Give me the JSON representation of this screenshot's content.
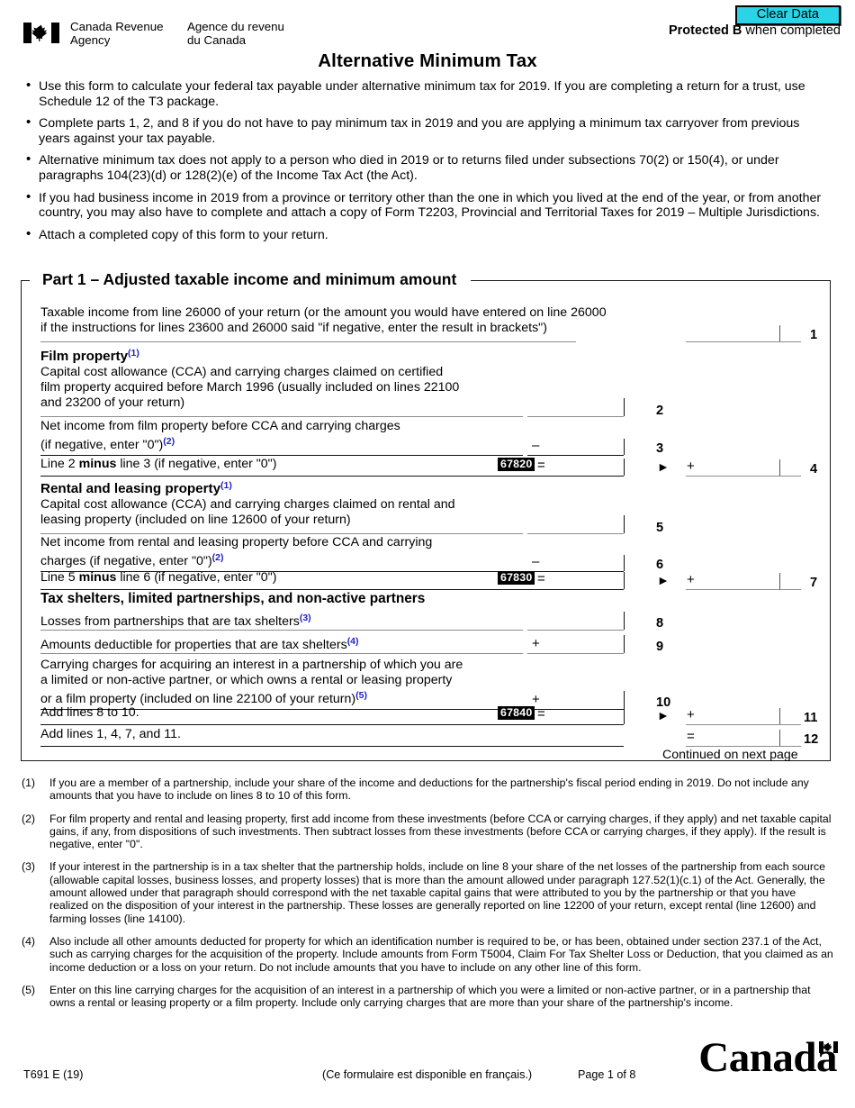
{
  "header": {
    "clear_data_label": "Clear Data",
    "agency_en": "Canada Revenue\nAgency",
    "agency_fr": "Agence du revenu\ndu Canada",
    "protected_strong": "Protected B",
    "protected_rest": " when completed",
    "form_title": "Alternative Minimum Tax"
  },
  "intro_bullets": [
    "Use this form to calculate your federal tax payable under alternative minimum tax for 2019. If you are completing a return for a trust, use Schedule 12 of the T3 package.",
    "Complete parts 1, 2, and 8 if you do not have to pay minimum tax in 2019 and you are applying a minimum tax carryover from previous years against your tax payable.",
    "Alternative minimum tax does not apply to a person who died in 2019 or to returns filed under subsections 70(2) or 150(4), or under paragraphs 104(23)(d) or 128(2)(e) of the Income Tax Act (the Act).",
    "If you had business income in 2019 from a province or territory other than the one in which you lived at the end of the year, or from another country, you may also have to complete and attach a copy of Form T2203, Provincial and Territorial Taxes for 2019 – Multiple Jurisdictions.",
    "Attach a completed copy of this form to your return."
  ],
  "part1": {
    "legend": "Part 1 – Adjusted taxable income and minimum amount",
    "continued": "Continued on next page",
    "line1_label_a": "Taxable income from line 26000 of your return (or the amount you would have entered on line 26000",
    "line1_label_b": "if the instructions for lines 23600 and 26000 said \"if negative, enter the result in brackets\")",
    "line1_num": "1",
    "film_heading": "Film property",
    "film_heading_fn": "(1)",
    "line2_label_a": "Capital cost allowance (CCA) and carrying charges claimed on certified",
    "line2_label_b": "film property acquired before March 1996 (usually included on lines 22100",
    "line2_label_c": "and 23200 of your return)",
    "line2_num": "2",
    "line3_label_a": "Net income from film property before CCA and carrying charges",
    "line3_label_b": "(if negative, enter \"0\")",
    "line3_fn": "(2)",
    "line3_op": "–",
    "line3_num": "3",
    "line4_label_pre": "Line 2 ",
    "line4_label_bold": "minus",
    "line4_label_post": " line 3 (if negative, enter \"0\")",
    "line4_code": "67820",
    "line4_eq": "=",
    "line4_op": "+",
    "line4_num": "4",
    "rental_heading": "Rental and leasing property",
    "rental_heading_fn": "(1)",
    "line5_label_a": "Capital cost allowance (CCA) and carrying charges claimed on rental and",
    "line5_label_b": "leasing property (included on line 12600 of your return)",
    "line5_num": "5",
    "line6_label_a": "Net income from rental and leasing property before CCA and carrying",
    "line6_label_b": "charges (if negative, enter \"0\")",
    "line6_fn": "(2)",
    "line6_op": "–",
    "line6_num": "6",
    "line7_label_pre": "Line 5 ",
    "line7_label_bold": "minus",
    "line7_label_post": " line 6 (if negative, enter \"0\")",
    "line7_code": "67830",
    "line7_eq": "=",
    "line7_op": "+",
    "line7_num": "7",
    "shelters_heading": "Tax shelters, limited partnerships, and non-active partners",
    "line8_label": "Losses from partnerships that are tax shelters",
    "line8_fn": "(3)",
    "line8_num": "8",
    "line9_label": "Amounts deductible for properties that are tax shelters",
    "line9_fn": "(4)",
    "line9_op": "+",
    "line9_num": "9",
    "line10_label_a": "Carrying charges for acquiring an interest in a partnership of which you are",
    "line10_label_b": "a limited or non-active partner, or which owns a rental or leasing property",
    "line10_label_c": "or a film property (included on line 22100 of your return)",
    "line10_fn": "(5)",
    "line10_op": "+",
    "line10_num": "10",
    "line11_label": "Add lines 8 to 10.",
    "line11_code": "67840",
    "line11_eq": "=",
    "line11_op": "+",
    "line11_num": "11",
    "line12_label": "Add lines 1, 4, 7, and 11.",
    "line12_eq": "=",
    "line12_num": "12"
  },
  "footnotes": [
    {
      "marker": "(1)",
      "text": "If you are a member of a partnership, include your share of the income and deductions for the partnership's fiscal period ending in 2019. Do not include any amounts that you have to include on lines 8 to 10 of this form."
    },
    {
      "marker": "(2)",
      "text": "For film property and rental and leasing property, first add income from these investments (before CCA or carrying charges, if they apply) and net taxable capital gains, if any, from dispositions of such investments. Then subtract losses from these investments (before CCA or carrying charges, if they apply). If the result is negative, enter \"0\"."
    },
    {
      "marker": "(3)",
      "text": "If your interest in the partnership is in a tax shelter that the partnership holds, include on line 8 your share of the net losses of the partnership from each source (allowable capital losses, business losses, and property losses) that is more than the amount allowed under paragraph 127.52(1)(c.1) of the Act. Generally, the amount allowed under that paragraph should correspond with the net taxable capital gains that were attributed to you by the partnership or that you have realized on the disposition of your interest in the partnership. These losses are generally reported on line 12200 of your return, except rental (line 12600) and farming losses (line 14100)."
    },
    {
      "marker": "(4)",
      "text": "Also include all other amounts deducted for property for which an identification number is required to be, or has been, obtained under section 237.1 of the Act, such as carrying charges for the acquisition of the property. Include amounts from Form T5004, Claim For Tax Shelter Loss or Deduction, that you claimed as an income deduction or a loss on your return. Do not include amounts that you have to include on any other line of this form."
    },
    {
      "marker": "(5)",
      "text": "Enter on this line carrying charges for the acquisition of an interest in a partnership of which you were a limited or non-active partner, or in a partnership that owns a rental or leasing property or a film property. Include only carrying charges that are more than your share of the partnership's income."
    }
  ],
  "footer": {
    "form_code": "T691 E (19)",
    "french_note": "(Ce formulaire est disponible en français.)",
    "page_number": "Page 1 of 8",
    "wordmark": "Canada"
  },
  "colors": {
    "clear_data_bg": "#2ad4e6",
    "footnote_marker": "#1f1fc8",
    "code_box_bg": "#000000",
    "rule": "#8d8d8d"
  }
}
